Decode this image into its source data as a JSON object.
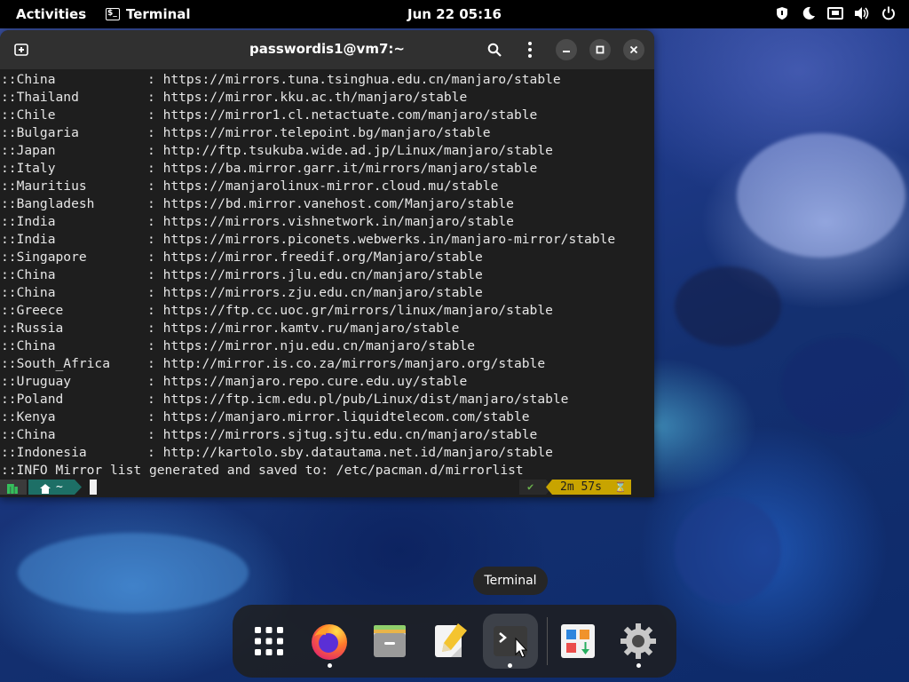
{
  "topbar": {
    "activities": "Activities",
    "app_name": "Terminal",
    "clock": "Jun 22  05:16",
    "tray_icons": [
      "privacy-shield-icon",
      "night-light-icon",
      "network-wired-icon",
      "volume-icon",
      "power-icon"
    ]
  },
  "terminal": {
    "title": "passwordis1@vm7:~",
    "mirrors": [
      {
        "country": "::China",
        "url": "https://mirrors.tuna.tsinghua.edu.cn/manjaro/stable"
      },
      {
        "country": "::Thailand",
        "url": "https://mirror.kku.ac.th/manjaro/stable"
      },
      {
        "country": "::Chile",
        "url": "https://mirror1.cl.netactuate.com/manjaro/stable"
      },
      {
        "country": "::Bulgaria",
        "url": "https://mirror.telepoint.bg/manjaro/stable"
      },
      {
        "country": "::Japan",
        "url": "http://ftp.tsukuba.wide.ad.jp/Linux/manjaro/stable"
      },
      {
        "country": "::Italy",
        "url": "https://ba.mirror.garr.it/mirrors/manjaro/stable"
      },
      {
        "country": "::Mauritius",
        "url": "https://manjarolinux-mirror.cloud.mu/stable"
      },
      {
        "country": "::Bangladesh",
        "url": "https://bd.mirror.vanehost.com/Manjaro/stable"
      },
      {
        "country": "::India",
        "url": "https://mirrors.vishnetwork.in/manjaro/stable"
      },
      {
        "country": "::India",
        "url": "https://mirrors.piconets.webwerks.in/manjaro-mirror/stable"
      },
      {
        "country": "::Singapore",
        "url": "https://mirror.freedif.org/Manjaro/stable"
      },
      {
        "country": "::China",
        "url": "https://mirrors.jlu.edu.cn/manjaro/stable"
      },
      {
        "country": "::China",
        "url": "https://mirrors.zju.edu.cn/manjaro/stable"
      },
      {
        "country": "::Greece",
        "url": "https://ftp.cc.uoc.gr/mirrors/linux/manjaro/stable"
      },
      {
        "country": "::Russia",
        "url": "https://mirror.kamtv.ru/manjaro/stable"
      },
      {
        "country": "::China",
        "url": "https://mirror.nju.edu.cn/manjaro/stable"
      },
      {
        "country": "::South_Africa",
        "url": "http://mirror.is.co.za/mirrors/manjaro.org/stable"
      },
      {
        "country": "::Uruguay",
        "url": "https://manjaro.repo.cure.edu.uy/stable"
      },
      {
        "country": "::Poland",
        "url": "https://ftp.icm.edu.pl/pub/Linux/dist/manjaro/stable"
      },
      {
        "country": "::Kenya",
        "url": "https://manjaro.mirror.liquidtelecom.com/stable"
      },
      {
        "country": "::China",
        "url": "https://mirrors.sjtug.sjtu.edu.cn/manjaro/stable"
      },
      {
        "country": "::Indonesia",
        "url": "http://kartolo.sby.datautama.net.id/manjaro/stable"
      }
    ],
    "info_prefix": "::INFO",
    "info_text": " Mirror list generated and saved to: /etc/pacman.d/mirrorlist",
    "prompt": {
      "home_symbol": "~",
      "check_symbol": "✔",
      "duration": "2m 57s",
      "hourglass": "⌛"
    }
  },
  "tooltip": "Terminal",
  "dock": [
    {
      "name": "app-grid",
      "running": false
    },
    {
      "name": "firefox",
      "running": true
    },
    {
      "name": "files",
      "running": false
    },
    {
      "name": "text-editor",
      "running": false
    },
    {
      "name": "terminal",
      "running": true
    },
    {
      "name": "software-store",
      "running": false
    },
    {
      "name": "settings",
      "running": true
    }
  ]
}
